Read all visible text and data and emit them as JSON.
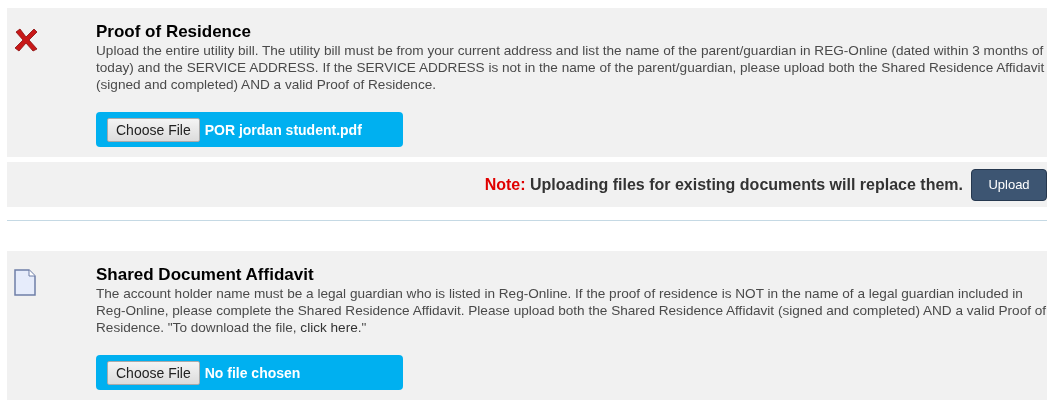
{
  "documents": [
    {
      "kind": "missing",
      "title": "Proof of Residence",
      "description": "Upload the entire utility bill. The utility bill must be from your current address and list the name of the parent/guardian in REG-Online (dated within 3 months of today) and the SERVICE ADDRESS. If the SERVICE ADDRESS is not in the name of the parent/guardian, please upload both the Shared Residence Affidavit (signed and completed) AND a valid Proof of Residence.",
      "file_button": "Choose File",
      "file_name": "POR jordan student.pdf",
      "note": {
        "label": "Note:",
        "text": "Uploading files for existing documents will replace them.",
        "button": "Upload"
      }
    },
    {
      "kind": "empty",
      "title": "Shared Document Affidavit",
      "description": "The account holder name must be a legal guardian who is listed in Reg-Online. If the proof of residence is NOT in the name of a legal guardian included in Reg-Online, please complete the Shared Residence Affidavit. Please upload both the Shared Residence Affidavit (signed and completed) AND a valid Proof of Residence. \"To download the file, ",
      "link": "click here",
      "description_end": ".\"",
      "file_button": "Choose File",
      "file_name": "No file chosen"
    }
  ]
}
